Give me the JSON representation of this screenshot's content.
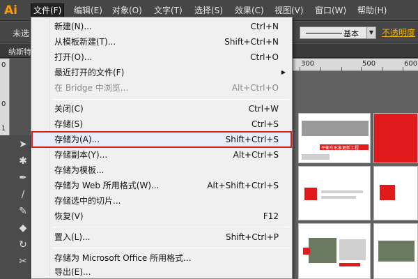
{
  "app": {
    "logo": "Ai"
  },
  "menubar": {
    "items": [
      "文件(F)",
      "编辑(E)",
      "对象(O)",
      "文字(T)",
      "选择(S)",
      "效果(C)",
      "视图(V)",
      "窗口(W)",
      "帮助(H)"
    ],
    "active_index": 0
  },
  "controlbar": {
    "label": "未选",
    "stroke_style": "基本",
    "opacity_label": "不透明度"
  },
  "document_tab": {
    "label": "纳斯特"
  },
  "ruler": {
    "top_numbers": [
      "300",
      "500",
      "600"
    ],
    "left_numbers": [
      "0",
      "0",
      "1"
    ]
  },
  "file_menu": {
    "items": [
      {
        "label": "新建(N)...",
        "shortcut": "Ctrl+N"
      },
      {
        "label": "从模板新建(T)...",
        "shortcut": "Shift+Ctrl+N"
      },
      {
        "label": "打开(O)...",
        "shortcut": "Ctrl+O"
      },
      {
        "label": "最近打开的文件(F)",
        "shortcut": "",
        "submenu": true
      },
      {
        "label": "在 Bridge 中浏览...",
        "shortcut": "Alt+Ctrl+O",
        "disabled": true
      },
      {
        "separator": true
      },
      {
        "label": "关闭(C)",
        "shortcut": "Ctrl+W"
      },
      {
        "label": "存储(S)",
        "shortcut": "Ctrl+S"
      },
      {
        "label": "存储为(A)...",
        "shortcut": "Shift+Ctrl+S",
        "highlighted": true
      },
      {
        "label": "存储副本(Y)...",
        "shortcut": "Alt+Ctrl+S"
      },
      {
        "label": "存储为模板...",
        "shortcut": ""
      },
      {
        "label": "存储为 Web 所用格式(W)...",
        "shortcut": "Alt+Shift+Ctrl+S"
      },
      {
        "label": "存储选中的切片...",
        "shortcut": ""
      },
      {
        "label": "恢复(V)",
        "shortcut": "F12"
      },
      {
        "separator": true
      },
      {
        "label": "置入(L)...",
        "shortcut": "Shift+Ctrl+P"
      },
      {
        "separator": true
      },
      {
        "label": "存储为 Microsoft Office 所用格式...",
        "shortcut": ""
      },
      {
        "label": "导出(E)...",
        "shortcut": ""
      }
    ]
  },
  "artboard_banner": "平衡车形象更新工程",
  "colors": {
    "accent": "#ff9a00",
    "highlight_border": "#e02020",
    "brand_red": "#e11b1b"
  },
  "tools": [
    "selection-icon",
    "magic-wand-icon",
    "pen-icon",
    "brush-icon",
    "pencil-icon",
    "eraser-icon",
    "rotate-icon",
    "warp-icon",
    "artboard-icon"
  ]
}
